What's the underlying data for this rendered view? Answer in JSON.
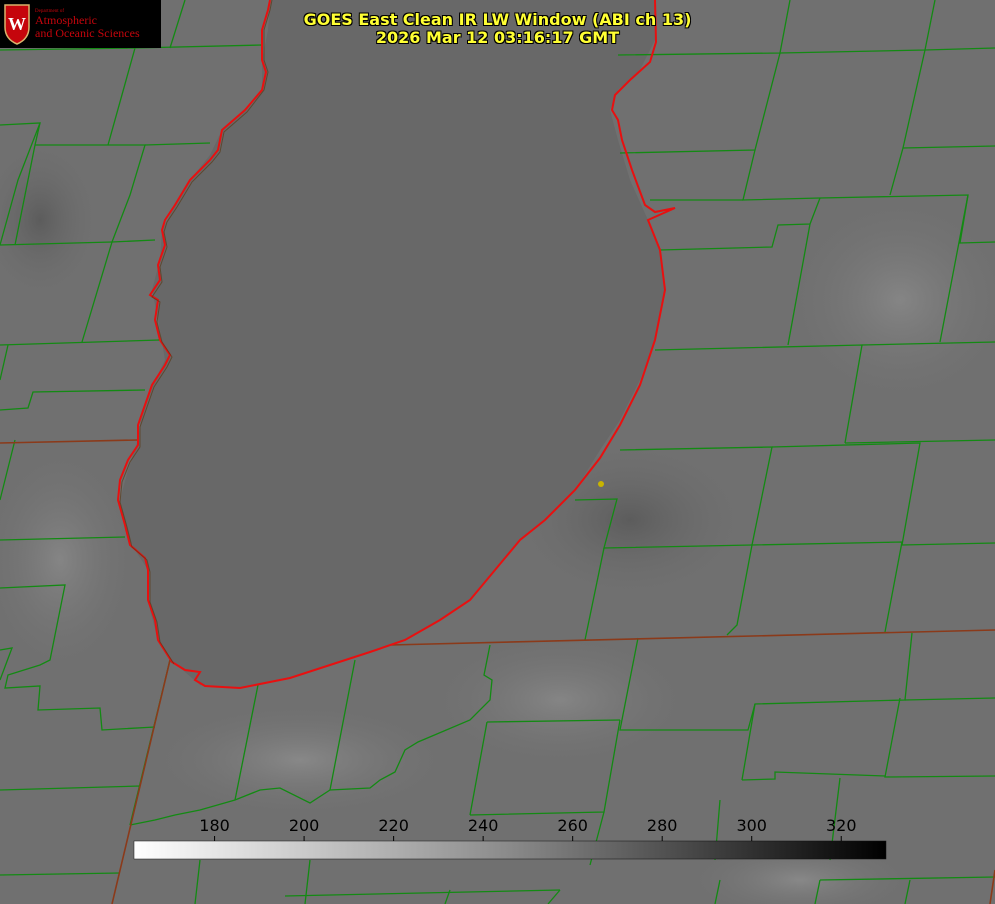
{
  "title": {
    "line1": "GOES East Clean IR LW Window (ABI ch 13)",
    "line2": "2026 Mar 12 03:16:17 GMT"
  },
  "logo": {
    "department": "Department of",
    "name_line1": "Atmospheric",
    "name_line2": "and Oceanic Sciences",
    "crest_letter": "W",
    "color": "#c5050c"
  },
  "colorbar": {
    "ticks": [
      "180",
      "200",
      "220",
      "240",
      "260",
      "280",
      "300",
      "320"
    ],
    "tick_values": [
      180,
      200,
      220,
      240,
      260,
      280,
      300,
      320
    ],
    "range": [
      162,
      330
    ],
    "colormap": "white-to-black"
  },
  "colors": {
    "background": "#6f6f6f",
    "county_lines": "#138a13",
    "state_lines": "#8b3a1a",
    "lake_outline": "#e81010",
    "lake_fill": "#686868",
    "title_text": "#ffff33",
    "marker": "#c8b400"
  }
}
